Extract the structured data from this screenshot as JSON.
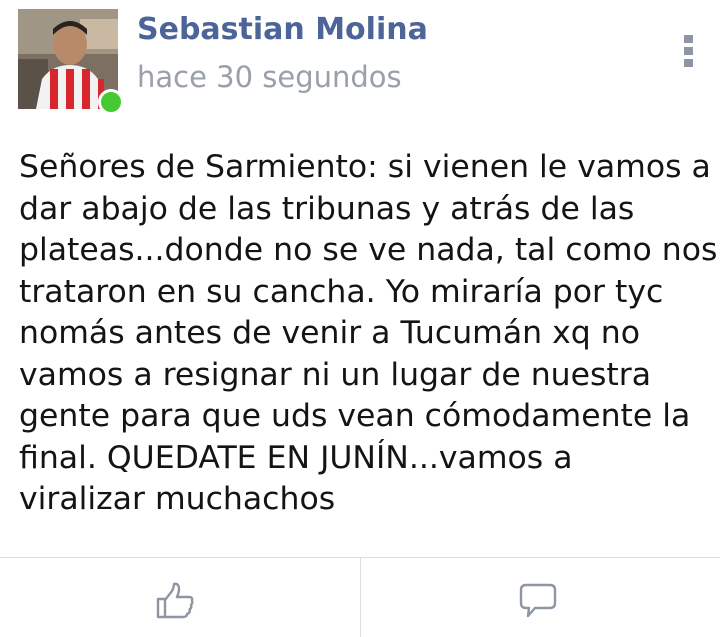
{
  "post": {
    "author_name": "Sebastian Molina",
    "timestamp": "hace 30 segundos",
    "online_status_color": "#46c932",
    "body_lines": [
      "Señores de Sarmiento: si vienen le vamos a",
      "dar abajo de las tribunas y atrás de las",
      "plateas...donde no se ve nada, tal como nos",
      "trataron en su cancha. Yo miraría por tyc",
      "nomás antes de venir a Tucumán xq no",
      "vamos a resignar ni un lugar de nuestra",
      "gente para que uds vean cómodamente la",
      "final. QUEDATE EN JUNÍN...vamos a",
      "viralizar muchachos"
    ]
  },
  "actions": {
    "like_icon": "thumbs-up-icon",
    "comment_icon": "speech-bubble-icon",
    "more_icon": "vertical-dots-icon"
  },
  "colors": {
    "author_name": "#4c6497",
    "timestamp": "#9aa0aa",
    "body_text": "#141414",
    "icon_gray": "#8f96a3",
    "divider": "#dcdee3"
  }
}
